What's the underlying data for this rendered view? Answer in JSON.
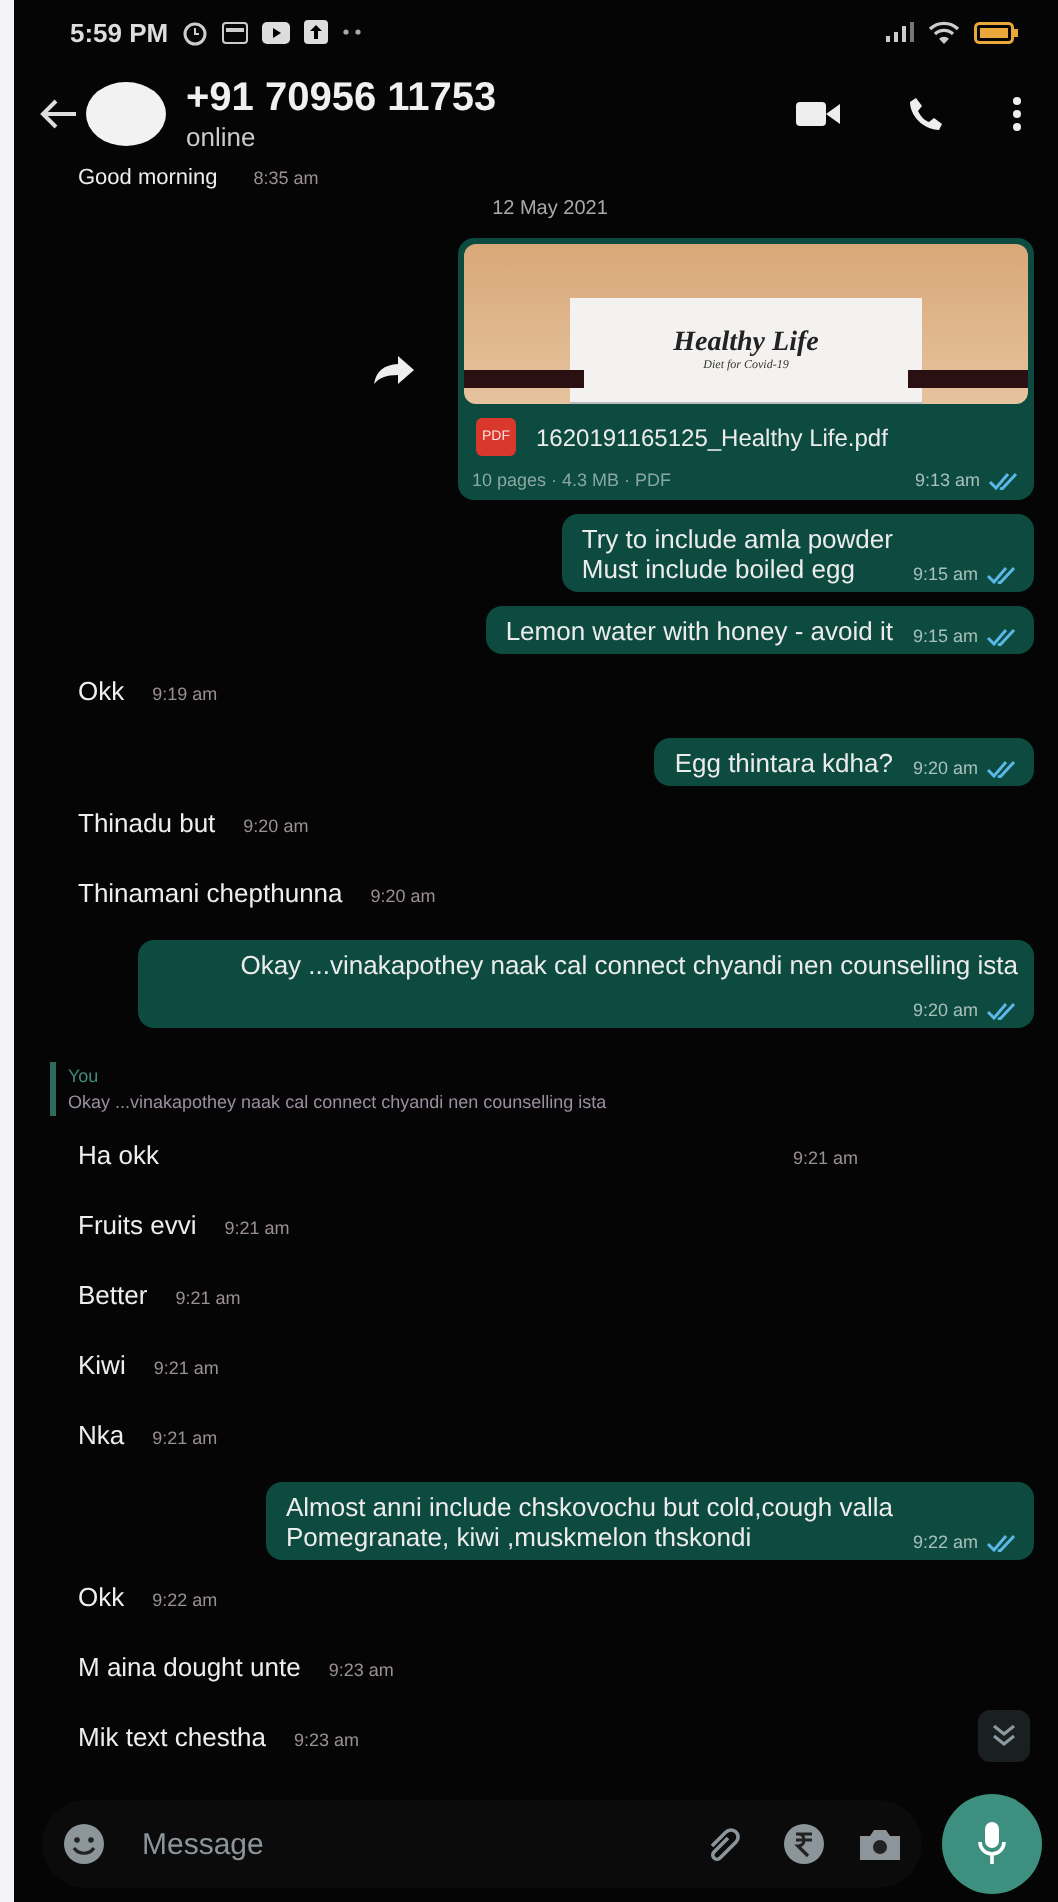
{
  "status_bar": {
    "time": "5:59 PM"
  },
  "header": {
    "title": "+91 70956 11753",
    "subtitle": "online"
  },
  "date_chip": "12 May 2021",
  "cut_message": {
    "text": "Good morning",
    "time": "8:35 am"
  },
  "messages": [
    {
      "kind": "pdf",
      "doc_title": "Healthy Life",
      "doc_subtitle": "Diet for Covid-19",
      "file_badge": "PDF",
      "file_name": "1620191165125_Healthy Life.pdf",
      "meta": "10 pages · 4.3 MB · PDF",
      "time": "9:13 am",
      "read": true
    },
    {
      "kind": "out",
      "text": "Try to include amla powder\nMust include  boiled egg",
      "time": "9:15 am",
      "read": true
    },
    {
      "kind": "out",
      "text": "Lemon water with honey - avoid it",
      "time": "9:15 am",
      "read": true
    },
    {
      "kind": "in",
      "text": "Okk",
      "time": "9:19 am"
    },
    {
      "kind": "out",
      "text": "Egg thintara kdha?",
      "time": "9:20 am",
      "read": true
    },
    {
      "kind": "in",
      "text": "Thinadu but",
      "time": "9:20 am"
    },
    {
      "kind": "in",
      "text": "Thinamani chepthunna",
      "time": "9:20 am"
    },
    {
      "kind": "out",
      "text": "Okay ...vinakapothey naak cal connect chyandi nen counselling ista",
      "time": "9:20 am",
      "read": true
    },
    {
      "kind": "reply",
      "quote_author": "You",
      "quote_text": "Okay ...vinakapothey naak cal connect chyandi nen counselling ista",
      "text": "Ha okk",
      "time": "9:21 am"
    },
    {
      "kind": "in",
      "text": "Fruits evvi",
      "time": "9:21 am"
    },
    {
      "kind": "in",
      "text": "Better",
      "time": "9:21 am"
    },
    {
      "kind": "in",
      "text": "Kiwi",
      "time": "9:21 am"
    },
    {
      "kind": "in",
      "text": "Nka",
      "time": "9:21 am"
    },
    {
      "kind": "out",
      "text": "Almost anni include chskovochu but cold,cough valla\nPomegranate, kiwi ,muskmelon  thskondi",
      "time": "9:22 am",
      "read": true
    },
    {
      "kind": "in",
      "text": "Okk",
      "time": "9:22 am"
    },
    {
      "kind": "in",
      "text": "M aina dought unte",
      "time": "9:23 am"
    },
    {
      "kind": "in",
      "text": "Mik text chestha",
      "time": "9:23 am"
    }
  ],
  "composer": {
    "placeholder": "Message"
  }
}
